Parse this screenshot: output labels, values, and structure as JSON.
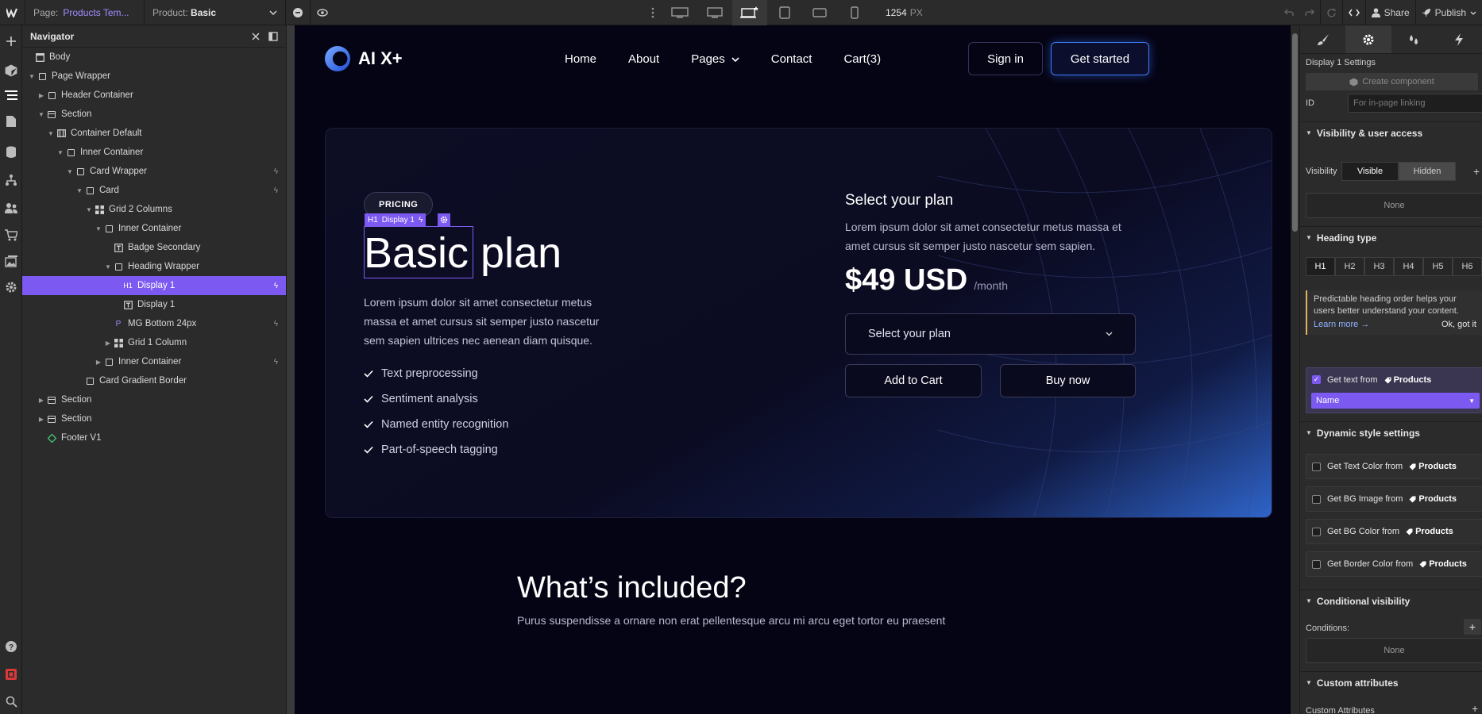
{
  "topbar": {
    "page_prefix": "Page:",
    "page_name": "Products Tem...",
    "product_prefix": "Product:",
    "product_name": "Basic",
    "canvas_width": "1254",
    "canvas_unit": "PX",
    "share_label": "Share",
    "publish_label": "Publish"
  },
  "navigator": {
    "title": "Navigator",
    "items": [
      {
        "label": "Body"
      },
      {
        "label": "Page Wrapper"
      },
      {
        "label": "Header Container"
      },
      {
        "label": "Section"
      },
      {
        "label": "Container Default"
      },
      {
        "label": "Inner Container"
      },
      {
        "label": "Card Wrapper"
      },
      {
        "label": "Card"
      },
      {
        "label": "Grid 2 Columns"
      },
      {
        "label": "Inner Container"
      },
      {
        "label": "Badge Secondary"
      },
      {
        "label": "Heading Wrapper"
      },
      {
        "label": "Display 1",
        "tag": "H1"
      },
      {
        "label": "Display 1"
      },
      {
        "label": "MG Bottom 24px",
        "tag": "P"
      },
      {
        "label": "Grid 1 Column"
      },
      {
        "label": "Inner Container"
      },
      {
        "label": "Card Gradient Border"
      },
      {
        "label": "Section"
      },
      {
        "label": "Section"
      },
      {
        "label": "Footer V1"
      }
    ]
  },
  "site": {
    "brand": "AI X+",
    "menu": [
      "Home",
      "About",
      "Pages",
      "Contact",
      "Cart(3)"
    ],
    "signin": "Sign in",
    "get_started": "Get started"
  },
  "card": {
    "badge": "PRICING",
    "selection_tag": "H1",
    "selection_label": "Display 1",
    "title": "Basic plan",
    "lead": "Lorem ipsum dolor sit amet consectetur metus massa et amet cursus sit semper justo nascetur sem sapien ultrices nec aenean diam quisque.",
    "features": [
      "Text preprocessing",
      "Sentiment analysis",
      "Named entity recognition",
      "Part-of-speech tagging"
    ],
    "select_title": "Select your plan",
    "select_text": "Lorem ipsum dolor sit amet consectetur metus massa et amet cursus sit semper justo nascetur sem sapien.",
    "price": "$49 USD",
    "per": "/month",
    "select_placeholder": "Select your plan",
    "add_to_cart": "Add to Cart",
    "buy_now": "Buy now"
  },
  "section2": {
    "title": "What’s included?",
    "text": "Purus suspendisse a ornare non erat pellentesque arcu mi arcu eget tortor eu praesent"
  },
  "panel": {
    "settings_title": "Display 1 Settings",
    "create_component": "Create component",
    "id_label": "ID",
    "id_placeholder": "For in-page linking",
    "visibility_section": "Visibility & user access",
    "visibility_label": "Visibility",
    "visible": "Visible",
    "hidden": "Hidden",
    "none": "None",
    "heading_type_section": "Heading type",
    "heading_levels": [
      "H1",
      "H2",
      "H3",
      "H4",
      "H5",
      "H6"
    ],
    "hint_text": "Predictable heading order helps your users better understand your content.",
    "learn_more": "Learn more →",
    "ok": "Ok, got it",
    "get_text_from": "Get text from",
    "products": "Products",
    "name_value": "Name",
    "dynamic_section": "Dynamic style settings",
    "dynamic_items": [
      "Get Text Color from",
      "Get BG Image from",
      "Get BG Color from",
      "Get Border Color from"
    ],
    "conditional_section": "Conditional visibility",
    "conditions_label": "Conditions:",
    "custom_attr_section": "Custom attributes",
    "custom_attr_label": "Custom Attributes"
  },
  "colors": {
    "accent": "#7c5af2",
    "canvas_bg": "#050414",
    "cta_border": "#3b7bff"
  }
}
